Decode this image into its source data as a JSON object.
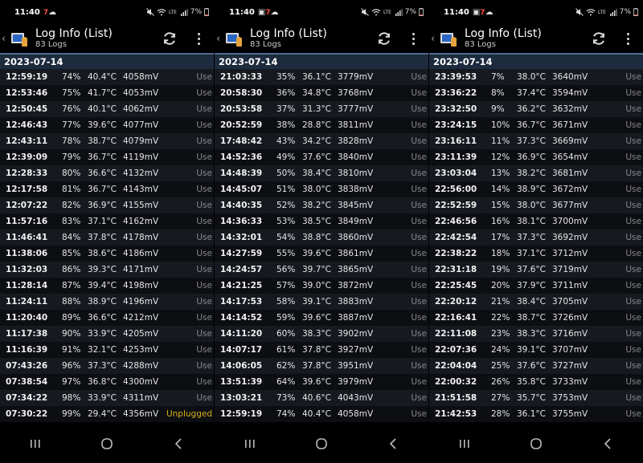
{
  "colors": {
    "date_bar": "#1d2b3e",
    "accent_unplugged": "#d7b01a",
    "notify_red": "#ff4b4b"
  },
  "icons": {
    "back": "back-chevron-icon",
    "app": "battery-log-app-icon",
    "refresh": "refresh-icon",
    "menu": "more-vert-icon",
    "nav": [
      "recent-apps-icon",
      "home-icon",
      "back-icon"
    ]
  },
  "panels": [
    {
      "status": {
        "time": "11:40",
        "left_icons": [
          "7",
          "☁"
        ],
        "battery": "7%"
      },
      "header": {
        "title": "Log Info (List)",
        "subtitle": "83 Logs"
      },
      "date": "2023-07-14",
      "rows": [
        [
          "12:59:19",
          "74%",
          "40.4°C",
          "4058mV",
          "Use"
        ],
        [
          "12:53:46",
          "75%",
          "41.7°C",
          "4053mV",
          "Use"
        ],
        [
          "12:50:45",
          "76%",
          "40.1°C",
          "4062mV",
          "Use"
        ],
        [
          "12:46:43",
          "77%",
          "39.6°C",
          "4077mV",
          "Use"
        ],
        [
          "12:43:11",
          "78%",
          "38.7°C",
          "4079mV",
          "Use"
        ],
        [
          "12:39:09",
          "79%",
          "36.7°C",
          "4119mV",
          "Use"
        ],
        [
          "12:28:33",
          "80%",
          "36.6°C",
          "4132mV",
          "Use"
        ],
        [
          "12:17:58",
          "81%",
          "36.7°C",
          "4143mV",
          "Use"
        ],
        [
          "12:07:22",
          "82%",
          "36.9°C",
          "4155mV",
          "Use"
        ],
        [
          "11:57:16",
          "83%",
          "37.1°C",
          "4162mV",
          "Use"
        ],
        [
          "11:46:41",
          "84%",
          "37.8°C",
          "4178mV",
          "Use"
        ],
        [
          "11:38:06",
          "85%",
          "38.6°C",
          "4186mV",
          "Use"
        ],
        [
          "11:32:03",
          "86%",
          "39.3°C",
          "4171mV",
          "Use"
        ],
        [
          "11:28:14",
          "87%",
          "39.4°C",
          "4198mV",
          "Use"
        ],
        [
          "11:24:11",
          "88%",
          "38.9°C",
          "4196mV",
          "Use"
        ],
        [
          "11:20:40",
          "89%",
          "36.6°C",
          "4212mV",
          "Use"
        ],
        [
          "11:17:38",
          "90%",
          "33.9°C",
          "4205mV",
          "Use"
        ],
        [
          "11:16:39",
          "91%",
          "32.1°C",
          "4253mV",
          "Use"
        ],
        [
          "07:43:26",
          "96%",
          "37.3°C",
          "4288mV",
          "Use"
        ],
        [
          "07:38:54",
          "97%",
          "36.8°C",
          "4300mV",
          "Use"
        ],
        [
          "07:34:22",
          "98%",
          "33.9°C",
          "4311mV",
          "Use"
        ],
        [
          "07:30:22",
          "99%",
          "29.4°C",
          "4356mV",
          "Unplugged"
        ]
      ]
    },
    {
      "status": {
        "time": "11:40",
        "left_icons": [
          "▣",
          "7",
          "☁"
        ],
        "battery": "7%"
      },
      "header": {
        "title": "Log Info (List)",
        "subtitle": "83 Logs"
      },
      "date": "2023-07-14",
      "rows": [
        [
          "21:03:33",
          "35%",
          "36.1°C",
          "3779mV",
          "Use"
        ],
        [
          "20:58:30",
          "36%",
          "34.8°C",
          "3768mV",
          "Use"
        ],
        [
          "20:53:58",
          "37%",
          "31.3°C",
          "3777mV",
          "Use"
        ],
        [
          "20:52:59",
          "38%",
          "28.8°C",
          "3811mV",
          "Use"
        ],
        [
          "17:48:42",
          "43%",
          "34.2°C",
          "3828mV",
          "Use"
        ],
        [
          "14:52:36",
          "49%",
          "37.6°C",
          "3840mV",
          "Use"
        ],
        [
          "14:48:39",
          "50%",
          "38.4°C",
          "3810mV",
          "Use"
        ],
        [
          "14:45:07",
          "51%",
          "38.0°C",
          "3838mV",
          "Use"
        ],
        [
          "14:40:35",
          "52%",
          "38.2°C",
          "3845mV",
          "Use"
        ],
        [
          "14:36:33",
          "53%",
          "38.5°C",
          "3849mV",
          "Use"
        ],
        [
          "14:32:01",
          "54%",
          "38.8°C",
          "3860mV",
          "Use"
        ],
        [
          "14:27:59",
          "55%",
          "39.6°C",
          "3861mV",
          "Use"
        ],
        [
          "14:24:57",
          "56%",
          "39.7°C",
          "3865mV",
          "Use"
        ],
        [
          "14:21:25",
          "57%",
          "39.0°C",
          "3872mV",
          "Use"
        ],
        [
          "14:17:53",
          "58%",
          "39.1°C",
          "3883mV",
          "Use"
        ],
        [
          "14:14:52",
          "59%",
          "39.6°C",
          "3887mV",
          "Use"
        ],
        [
          "14:11:20",
          "60%",
          "38.3°C",
          "3902mV",
          "Use"
        ],
        [
          "14:07:17",
          "61%",
          "37.8°C",
          "3927mV",
          "Use"
        ],
        [
          "14:06:05",
          "62%",
          "37.8°C",
          "3951mV",
          "Use"
        ],
        [
          "13:51:39",
          "64%",
          "39.6°C",
          "3979mV",
          "Use"
        ],
        [
          "13:03:21",
          "73%",
          "40.6°C",
          "4043mV",
          "Use"
        ],
        [
          "12:59:19",
          "74%",
          "40.4°C",
          "4058mV",
          "Use"
        ]
      ]
    },
    {
      "status": {
        "time": "11:40",
        "left_icons": [
          "▣",
          "7",
          "☁"
        ],
        "battery": "7%"
      },
      "header": {
        "title": "Log Info (List)",
        "subtitle": "83 Logs"
      },
      "date": "2023-07-14",
      "rows": [
        [
          "23:39:53",
          "7%",
          "38.0°C",
          "3640mV",
          "Use"
        ],
        [
          "23:36:22",
          "8%",
          "37.4°C",
          "3594mV",
          "Use"
        ],
        [
          "23:32:50",
          "9%",
          "36.2°C",
          "3632mV",
          "Use"
        ],
        [
          "23:24:15",
          "10%",
          "36.7°C",
          "3671mV",
          "Use"
        ],
        [
          "23:16:11",
          "11%",
          "37.3°C",
          "3669mV",
          "Use"
        ],
        [
          "23:11:39",
          "12%",
          "36.9°C",
          "3654mV",
          "Use"
        ],
        [
          "23:03:04",
          "13%",
          "38.2°C",
          "3681mV",
          "Use"
        ],
        [
          "22:56:00",
          "14%",
          "38.9°C",
          "3672mV",
          "Use"
        ],
        [
          "22:52:59",
          "15%",
          "38.0°C",
          "3677mV",
          "Use"
        ],
        [
          "22:46:56",
          "16%",
          "38.1°C",
          "3700mV",
          "Use"
        ],
        [
          "22:42:54",
          "17%",
          "37.3°C",
          "3692mV",
          "Use"
        ],
        [
          "22:38:22",
          "18%",
          "37.1°C",
          "3712mV",
          "Use"
        ],
        [
          "22:31:18",
          "19%",
          "37.6°C",
          "3719mV",
          "Use"
        ],
        [
          "22:25:45",
          "20%",
          "37.9°C",
          "3711mV",
          "Use"
        ],
        [
          "22:20:12",
          "21%",
          "38.4°C",
          "3705mV",
          "Use"
        ],
        [
          "22:16:41",
          "22%",
          "38.7°C",
          "3726mV",
          "Use"
        ],
        [
          "22:11:08",
          "23%",
          "38.3°C",
          "3716mV",
          "Use"
        ],
        [
          "22:07:36",
          "24%",
          "39.1°C",
          "3707mV",
          "Use"
        ],
        [
          "22:04:04",
          "25%",
          "37.6°C",
          "3727mV",
          "Use"
        ],
        [
          "22:00:32",
          "26%",
          "35.8°C",
          "3733mV",
          "Use"
        ],
        [
          "21:51:58",
          "27%",
          "35.7°C",
          "3753mV",
          "Use"
        ],
        [
          "21:42:53",
          "28%",
          "36.1°C",
          "3755mV",
          "Use"
        ]
      ]
    }
  ]
}
